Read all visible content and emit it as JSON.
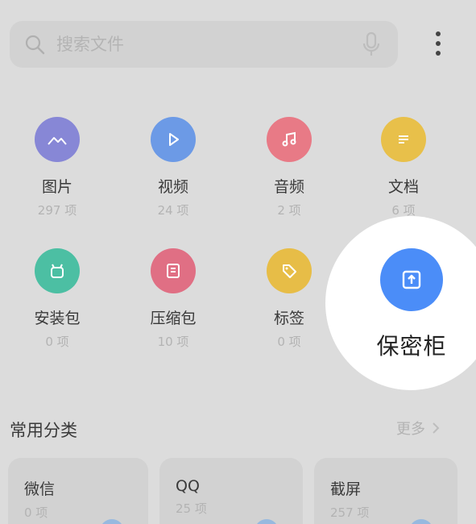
{
  "search": {
    "placeholder": "搜索文件"
  },
  "categories": [
    {
      "label": "图片",
      "count": "297 项",
      "color": "#8787d6",
      "icon": "image-icon"
    },
    {
      "label": "视频",
      "count": "24 项",
      "color": "#6c9ae6",
      "icon": "play-icon"
    },
    {
      "label": "音频",
      "count": "2 项",
      "color": "#e87a86",
      "icon": "music-icon"
    },
    {
      "label": "文档",
      "count": "6 项",
      "color": "#e8c04a",
      "icon": "document-icon"
    },
    {
      "label": "安装包",
      "count": "0 项",
      "color": "#4cbfa3",
      "icon": "android-icon"
    },
    {
      "label": "压缩包",
      "count": "10 项",
      "color": "#e06f84",
      "icon": "archive-icon"
    },
    {
      "label": "标签",
      "count": "0 项",
      "color": "#e7bd47",
      "icon": "tag-icon"
    }
  ],
  "vault": {
    "label": "保密柜",
    "color": "#4b8df8",
    "icon": "vault-icon"
  },
  "common": {
    "title": "常用分类",
    "more": "更多",
    "cards": [
      {
        "title": "微信",
        "count": "0 项"
      },
      {
        "title": "QQ",
        "count": "25 项"
      },
      {
        "title": "截屏",
        "count": "257 项"
      }
    ]
  }
}
